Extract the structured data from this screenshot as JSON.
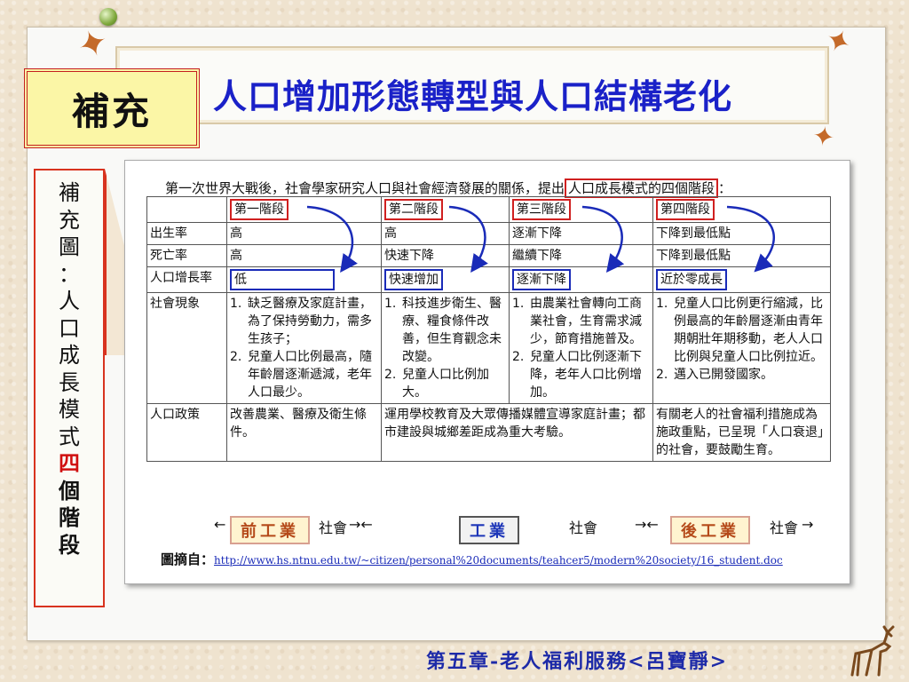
{
  "slide": {
    "badge": "補充",
    "title": "人口增加形態轉型與人口結構老化",
    "side_chars": [
      "補",
      "充",
      "圖",
      "：",
      "人",
      "口",
      "成",
      "長",
      "模",
      "式",
      "四",
      "個",
      "階",
      "段"
    ],
    "footer": "第五章-老人福利服務<呂寶靜>"
  },
  "figure": {
    "intro_pre": "第一次世界大戰後，社會學家研究人口與社會經濟發展的關係，提出",
    "intro_highlight": "人口成長模式的四個階段",
    "intro_post": "：",
    "stages": [
      "第一階段",
      "第二階段",
      "第三階段",
      "第四階段"
    ],
    "rows": {
      "birth": {
        "label": "出生率",
        "values": [
          "高",
          "高",
          "逐漸下降",
          "下降到最低點"
        ]
      },
      "death": {
        "label": "死亡率",
        "values": [
          "高",
          "快速下降",
          "繼續下降",
          "下降到最低點"
        ]
      },
      "growth": {
        "label": "人口增長率",
        "values": [
          "低",
          "快速增加",
          "逐漸下降",
          "近於零成長"
        ]
      },
      "social": {
        "label": "社會現象",
        "s1": [
          "缺乏醫療及家庭計畫，為了保持勞動力，需多生孩子；",
          "兒童人口比例最高，隨年齡層逐漸遞減，老年人口最少。"
        ],
        "s2": [
          "科技進步衛生、醫療、糧食條件改善，但生育觀念未改變。",
          "兒童人口比例加大。"
        ],
        "s3": [
          "由農業社會轉向工商業社會，生育需求減少，節育措施普及。",
          "兒童人口比例逐漸下降，老年人口比例增加。"
        ],
        "s4": [
          "兒童人口比例更行縮減，比例最高的年齡層逐漸由青年期朝壯年期移動，老人人口比例與兒童人口比例拉近。",
          "邁入已開發國家。"
        ]
      },
      "policy": {
        "label": "人口政策",
        "values": [
          "改善農業、醫療及衛生條件。",
          "運用學校教育及大眾傳播媒體宣導家庭計畫；都市建設與城鄉差距成為重大考驗。",
          "",
          "有關老人的社會福利措施成為施政重點，已呈現「人口衰退」的社會，要鼓勵生育。"
        ]
      }
    },
    "society_labels": {
      "pre_industrial": "前工業",
      "industrial": "工業",
      "post_industrial": "後工業",
      "society": "社會"
    },
    "source_label": "圖摘自：",
    "source_url": "http://www.hs.ntnu.edu.tw/~citizen/personal%20documents/teahcer5/modern%20society/16_student.doc"
  },
  "colors": {
    "title_blue": "#1a21c8",
    "badge_yellow": "#fbf6a6",
    "accent_red": "#d02020",
    "box_blue": "#1a2bb8",
    "footer_blue": "#1d2aa8"
  }
}
